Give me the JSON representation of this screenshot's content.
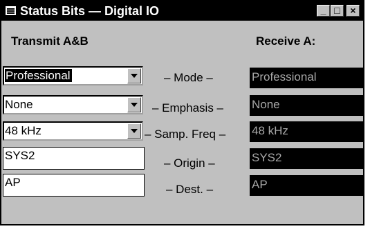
{
  "window": {
    "title": "Status Bits — Digital IO",
    "buttons": {
      "minimize": "_",
      "maximize": "□",
      "close": "×"
    }
  },
  "headers": {
    "transmit": "Transmit A&B",
    "receive": "Receive A:"
  },
  "rows": [
    {
      "label": "– Mode –",
      "transmit_value": "Professional",
      "receive_value": "Professional",
      "control": "dropdown",
      "focused": true
    },
    {
      "label": "– Emphasis –",
      "transmit_value": "None",
      "receive_value": "None",
      "control": "dropdown"
    },
    {
      "label": "– Samp. Freq –",
      "transmit_value": "48 kHz",
      "receive_value": "48 kHz",
      "control": "dropdown"
    },
    {
      "label": "– Origin –",
      "transmit_value": "SYS2",
      "receive_value": "SYS2",
      "control": "text"
    },
    {
      "label": "– Dest. –",
      "transmit_value": "AP",
      "receive_value": "AP",
      "control": "text"
    }
  ],
  "icons": {
    "system_menu": "window-menu-icon",
    "dropdown": "chevron-down-icon"
  },
  "colors": {
    "face": "#c0c0c0",
    "titlebar": "#000000",
    "receive_bg": "#000000",
    "receive_text": "#a8a8a8"
  }
}
